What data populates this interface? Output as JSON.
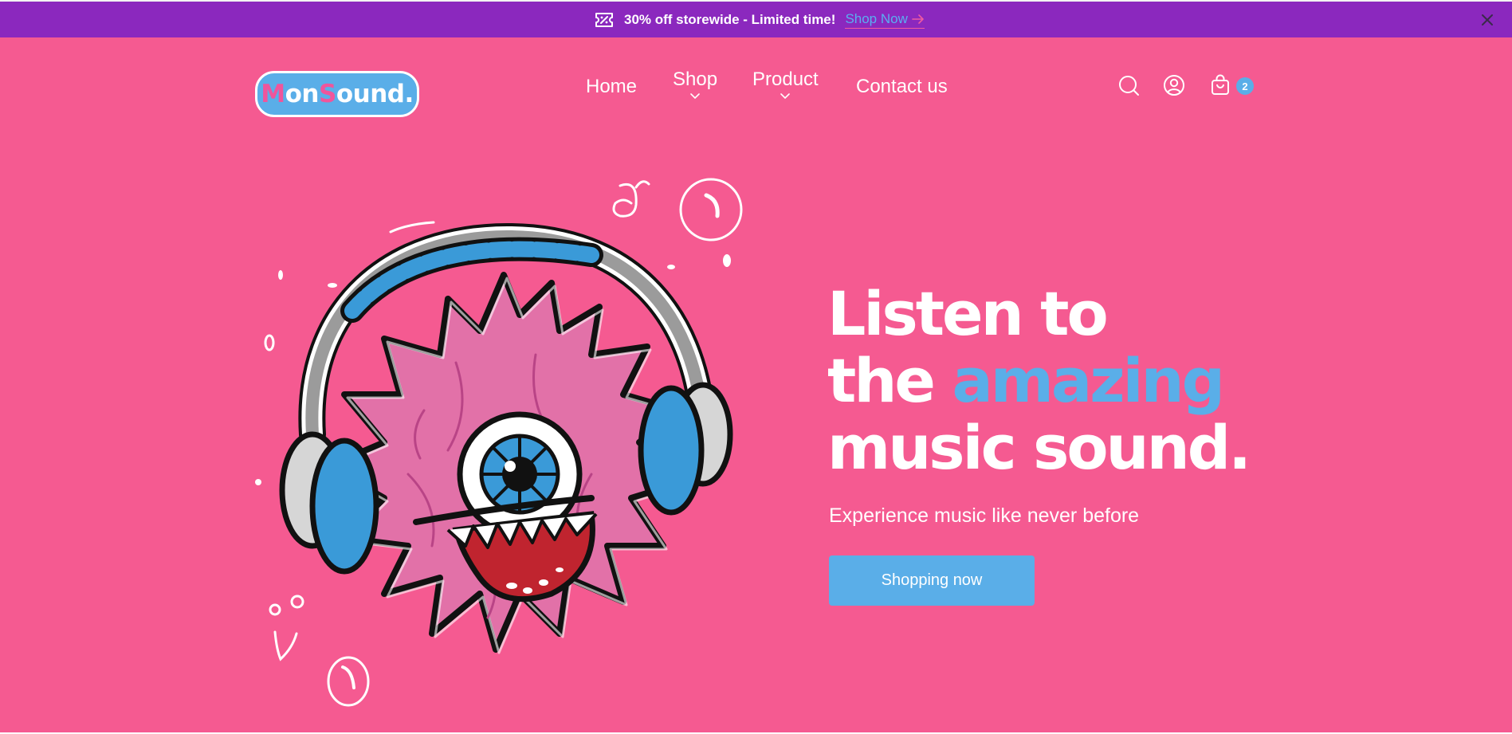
{
  "announcement": {
    "text": "30% off storewide - Limited time!",
    "link_label": "Shop Now"
  },
  "header": {
    "logo": {
      "part1": "M",
      "part2": "on",
      "part3": "S",
      "part4": "ound."
    },
    "nav": [
      {
        "label": "Home",
        "has_dropdown": false
      },
      {
        "label": "Shop",
        "has_dropdown": true
      },
      {
        "label": "Product",
        "has_dropdown": true
      },
      {
        "label": "Contact us",
        "has_dropdown": false
      }
    ],
    "cart_count": "2"
  },
  "hero": {
    "line1": "Listen to",
    "line2_prefix": "the ",
    "line2_accent": "amazing",
    "line3": "music sound.",
    "subtitle": "Experience music like never before",
    "cta": "Shopping now"
  },
  "colors": {
    "announcement_bg": "#8b28be",
    "hero_bg": "#f55a91",
    "accent_blue": "#5aaee8",
    "link_underline": "#f05aa0"
  },
  "icons": [
    "discount-ticket-icon",
    "arrow-right-icon",
    "close-icon",
    "chevron-down-icon",
    "search-icon",
    "user-icon",
    "shopping-bag-icon"
  ]
}
